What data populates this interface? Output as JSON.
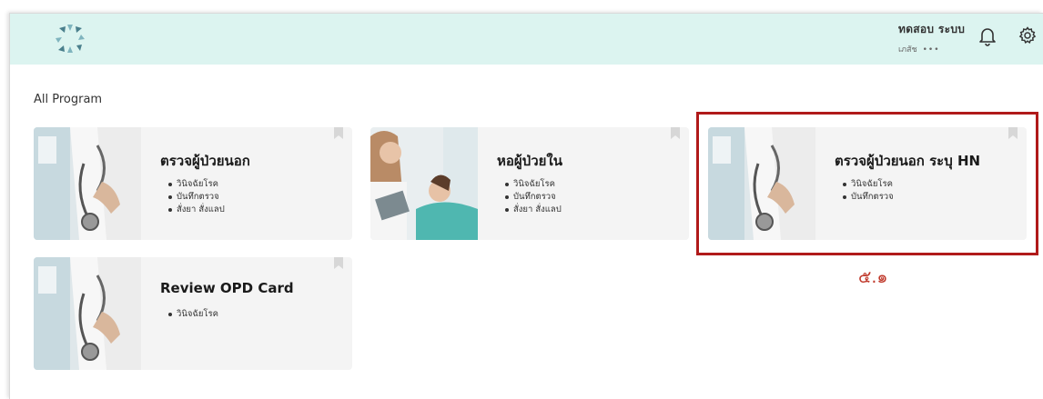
{
  "header": {
    "user_name": "ทดสอบ ระบบ",
    "user_role": "เภสัช",
    "more": "•••"
  },
  "section_title": "All Program",
  "cards": [
    {
      "title": "ตรวจผู้ป่วยนอก",
      "items": [
        "วินิจฉัยโรค",
        "บันทึกตรวจ",
        "สั่งยา สั่งแลป"
      ]
    },
    {
      "title": "หอผู้ป่วยใน",
      "items": [
        "วินิจฉัยโรค",
        "บันทึกตรวจ",
        "สั่งยา สั่งแลป"
      ]
    },
    {
      "title": "ตรวจผู้ป่วยนอก ระบุ HN",
      "items": [
        "วินิจฉัยโรค",
        "บันทึกตรวจ"
      ]
    },
    {
      "title": "Review OPD Card",
      "items": [
        "วินิจฉัยโรค"
      ]
    }
  ],
  "annotation": "๕.๑",
  "colors": {
    "topbar": "#dcf4f0",
    "highlight": "#b01a1a",
    "annotation": "#c0392b",
    "card_bg": "#f4f4f4",
    "logo": "#4a7f8c"
  },
  "icons": [
    "logo-icon",
    "bell-icon",
    "gear-icon",
    "bookmark-icon",
    "doctor-stethoscope-image",
    "ward-nurse-image"
  ]
}
